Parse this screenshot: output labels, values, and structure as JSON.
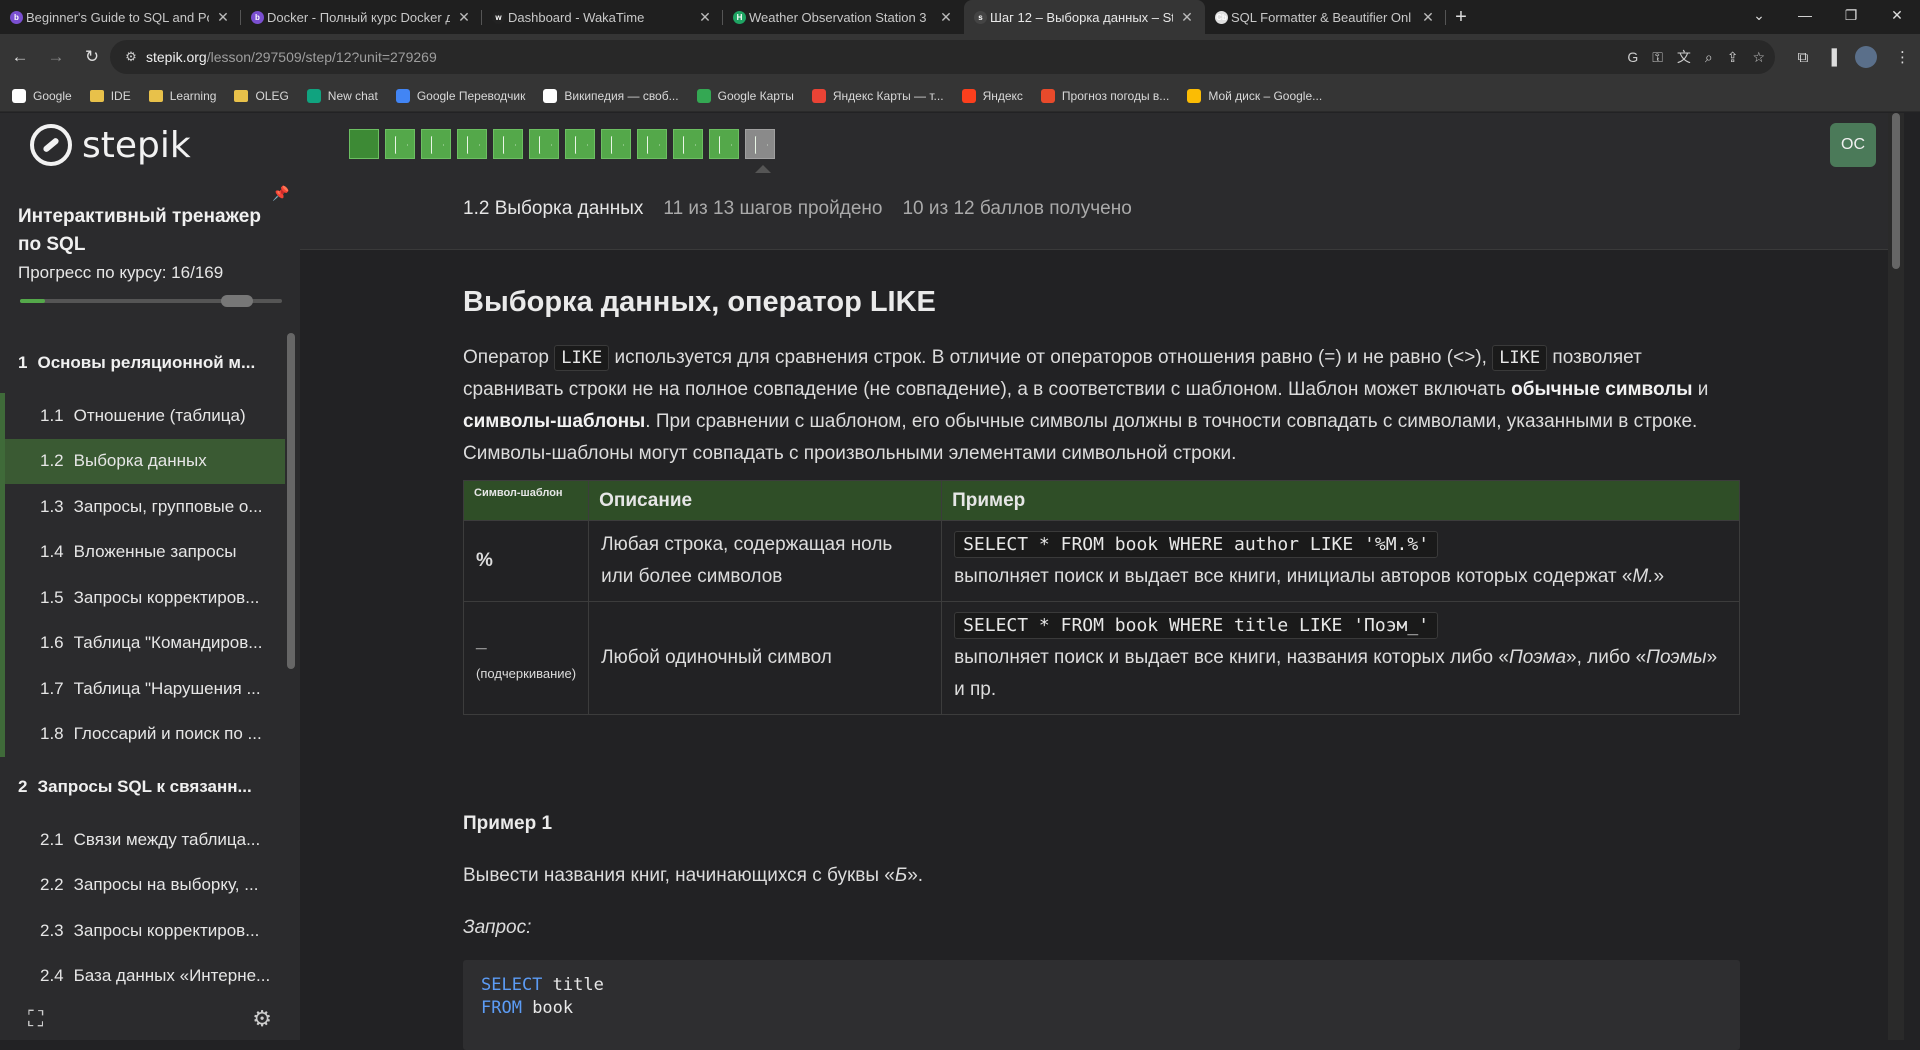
{
  "browser": {
    "tabs": [
      {
        "title": "Beginner's Guide to SQL and Po",
        "fav_color": "#7a4fd0",
        "fav": "b"
      },
      {
        "title": "Docker - Полный курс Docker д",
        "fav_color": "#7a4fd0",
        "fav": "b"
      },
      {
        "title": "Dashboard - WakaTime",
        "fav_color": "#222222",
        "fav": "w"
      },
      {
        "title": "Weather Observation Station 3",
        "fav_color": "#1fa463",
        "fav": "H"
      },
      {
        "title": "Шаг 12 – Выборка данных – St",
        "fav_color": "#444444",
        "fav": "s"
      },
      {
        "title": "SQL Formatter & Beautifier Onl",
        "fav_color": "#e0e0e0",
        "fav": "Cb"
      }
    ],
    "active_tab_index": 4,
    "url_host": "stepik.org",
    "url_path": "/lesson/297509/step/12?unit=279269",
    "bookmarks": [
      {
        "label": "Google",
        "type": "site",
        "color": "#ffffff"
      },
      {
        "label": "IDE",
        "type": "folder"
      },
      {
        "label": "Learning",
        "type": "folder"
      },
      {
        "label": "OLEG",
        "type": "folder"
      },
      {
        "label": "New chat",
        "type": "site",
        "color": "#10a37f"
      },
      {
        "label": "Google Переводчик",
        "type": "site",
        "color": "#4285f4"
      },
      {
        "label": "Википедия — своб...",
        "type": "site",
        "color": "#ffffff"
      },
      {
        "label": "Google Карты",
        "type": "site",
        "color": "#34a853"
      },
      {
        "label": "Яндекс Карты — т...",
        "type": "site",
        "color": "#ea4335"
      },
      {
        "label": "Яндекс",
        "type": "site",
        "color": "#fc3f1d"
      },
      {
        "label": "Прогноз погоды в...",
        "type": "site",
        "color": "#e84a2b"
      },
      {
        "label": "Мой диск – Google...",
        "type": "site",
        "color": "#fbbc04"
      }
    ]
  },
  "sidebar": {
    "logo_text": "stepik",
    "course_title": "Интерактивный тренажер по SQL",
    "progress_label": "Прогресс по курсу:  16/169",
    "progress_fraction": 0.095,
    "modules": [
      {
        "num": "1",
        "title": "Основы реляционной м...",
        "lessons": [
          {
            "num": "1.1",
            "title": "Отношение (таблица)"
          },
          {
            "num": "1.2",
            "title": "Выборка данных",
            "active": true
          },
          {
            "num": "1.3",
            "title": "Запросы, групповые о..."
          },
          {
            "num": "1.4",
            "title": "Вложенные запросы"
          },
          {
            "num": "1.5",
            "title": "Запросы корректиров..."
          },
          {
            "num": "1.6",
            "title": "Таблица \"Командиров..."
          },
          {
            "num": "1.7",
            "title": "Таблица \"Нарушения ..."
          },
          {
            "num": "1.8",
            "title": "Глоссарий и поиск по ..."
          }
        ]
      },
      {
        "num": "2",
        "title": "Запросы SQL к связанн...",
        "lessons": [
          {
            "num": "2.1",
            "title": "Связи между таблица..."
          },
          {
            "num": "2.2",
            "title": "Запросы на выборку, ..."
          },
          {
            "num": "2.3",
            "title": "Запросы корректиров..."
          },
          {
            "num": "2.4",
            "title": "База данных «Интерне..."
          }
        ]
      }
    ]
  },
  "topbar": {
    "steps_total": 13,
    "steps_passed": 11,
    "current_step": 12,
    "user_initials": "OC",
    "lesson_name": "1.2 Выборка данных",
    "steps_status": "11 из 13 шагов пройдено",
    "points_status": "10 из 12 баллов  получено"
  },
  "content": {
    "title": "Выборка данных, оператор LIKE",
    "p_intro1": "Оператор ",
    "p_like1": "LIKE",
    "p_intro2": " используется для сравнения строк. В отличие от операторов отношения равно (=) и не равно (<>), ",
    "p_like2": "LIKE",
    "p_intro3": " позволяет сравнивать строки не на полное совпадение (не совпадение), а в соответствии с шаблоном. Шаблон может включать ",
    "p_bold1": "обычные символы",
    "p_and": " и ",
    "p_bold2": "символы-шаблоны",
    "p_intro4": ". При сравнении с шаблоном, его обычные символы должны в точности совпадать с символами, указанными в строке. Символы-шаблоны могут совпадать с произвольными элементами символьной строки.",
    "table": {
      "headers": [
        "Символ-шаблон",
        "Описание",
        "Пример"
      ],
      "rows": [
        {
          "symbol": "%",
          "symbol_note": "",
          "description": "Любая строка, содержащая ноль или более символов",
          "example_code": "SELECT * FROM book WHERE author LIKE '%М.%'",
          "example_text_a": "выполняет поиск и выдает все книги, инициалы авторов которых содержат «",
          "example_em1": "М.",
          "example_text_b": "»",
          "example_em2": "",
          "example_text_c": ""
        },
        {
          "symbol": "_",
          "symbol_note": "(подчеркивание)",
          "description": "Любой одиночный символ",
          "example_code": "SELECT * FROM book WHERE title LIKE 'Поэм_'",
          "example_text_a": "выполняет поиск и выдает все книги, названия которых либо «",
          "example_em1": "Поэма",
          "example_text_b": "», либо «",
          "example_em2": "Поэмы",
          "example_text_c": "» и пр."
        }
      ]
    },
    "example_heading": "Пример 1",
    "example_text_prefix": "Вывести названия книг, начинающихся с буквы «",
    "example_text_em": "Б",
    "example_text_suffix": "».",
    "query_label": "Запрос:",
    "code_kw1": "SELECT",
    "code_rest1": " title",
    "code_kw2": "FROM",
    "code_rest2": " book"
  }
}
